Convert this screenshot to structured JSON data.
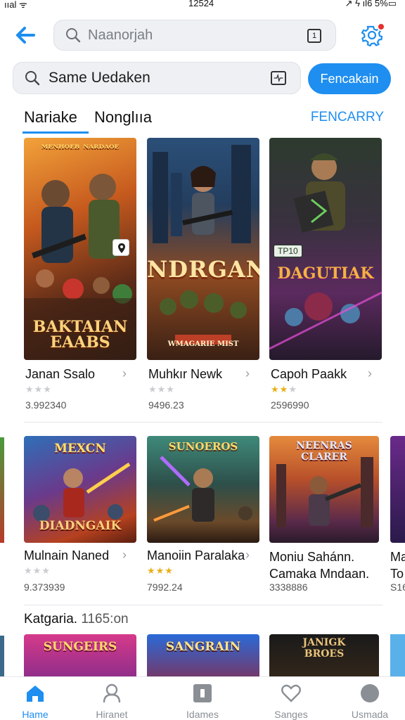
{
  "status": {
    "left": "ııal ᯤ",
    "time": "12524",
    "right": "↗ ϟ ıl6 5%▭"
  },
  "header": {
    "search_placeholder": "Naanorjah",
    "search_box_icon": "1"
  },
  "search": {
    "value": "Same Uedaken",
    "button_label": "Fencakain"
  },
  "tabs": {
    "items": [
      {
        "label": "Nariake"
      },
      {
        "label": "Nonglııa"
      }
    ],
    "action_label": "FENCARRY"
  },
  "rows": [
    {
      "cards": [
        {
          "art_top": "ᴹᴱᴺᴴᴼᴱᴮ ᴺᴬᴿᴰᴬᴼᴱ",
          "art_bottom": "BAKTAIAN EAABS",
          "title": "Janan Ssalo",
          "stars": "★★★",
          "rating": 0,
          "count": "3.992340"
        },
        {
          "art_top": "NDRGAN",
          "art_bottom": "WMAGARIE MIST",
          "title": "Muhkır Newk",
          "stars": "★★★",
          "rating": 0,
          "count": "9496.23"
        },
        {
          "art_top": "DAGUTIAK",
          "art_bottom": "TP10",
          "title": "Capoh Paakk",
          "stars": "★★★",
          "rating": 2,
          "count": "2596990"
        }
      ]
    },
    {
      "cards": [
        {
          "art_top": "MEXCN",
          "art_bottom": "DIADNGAIK",
          "title": "Mulnain Naned",
          "stars": "★★★",
          "rating": 0,
          "count": "9.373939"
        },
        {
          "art_top": "SUNOEROS",
          "art_bottom": "",
          "title": "Manoiin Paralaka",
          "stars": "★★★",
          "rating": 3,
          "count": "7992.24"
        },
        {
          "art_top": "NEENRAS CLARER",
          "art_bottom": "",
          "title": "Moniu Sahánn. Camaka Mndaan.",
          "stars": "",
          "rating": 0,
          "count": "3338886"
        },
        {
          "art_top": "",
          "art_bottom": "",
          "title": "Ma To",
          "stars": "",
          "rating": 0,
          "count": "S16"
        }
      ]
    }
  ],
  "section": {
    "title": "Katgaria.",
    "count": "1165:on"
  },
  "row3": {
    "cards": [
      {
        "art_top": "SUNGEIRS"
      },
      {
        "art_top": "SANGRAIN"
      },
      {
        "art_top": "JANIGK BROES"
      }
    ]
  },
  "nav": {
    "items": [
      {
        "label": "Hame",
        "icon": "home-icon"
      },
      {
        "label": "Hiranet",
        "icon": "person-icon"
      },
      {
        "label": "Idames",
        "icon": "square-icon"
      },
      {
        "label": "Sanges",
        "icon": "heart-icon"
      },
      {
        "label": "Usmada",
        "icon": "circle-icon"
      }
    ]
  },
  "colors": {
    "accent": "#1e8ef0",
    "badge": "#e5322d",
    "star_gold": "#e8b01a",
    "star_grey": "#c9ccd0"
  }
}
